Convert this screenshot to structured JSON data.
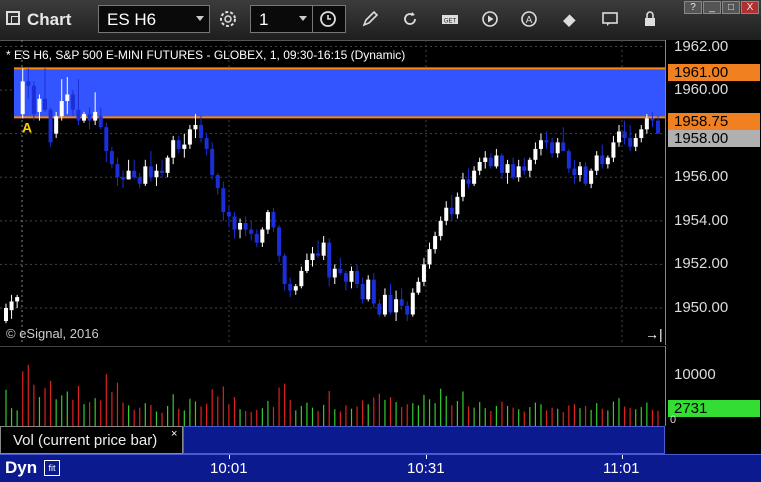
{
  "app": {
    "title": "Chart"
  },
  "toolbar": {
    "symbol": "ES H6",
    "interval": "1",
    "icons": [
      "gear-icon",
      "clock-icon",
      "pencil-icon",
      "refresh-icon",
      "get-icon",
      "play-icon",
      "alert-icon",
      "eraser-icon",
      "comment-icon",
      "lock-icon"
    ]
  },
  "window": {
    "help": "?",
    "minimize": "_",
    "maximize": "□",
    "close": "X"
  },
  "chart_data": {
    "type": "candlestick",
    "title": "* ES H6, S&P 500 E-MINI FUTURES - GLOBEX, 1, 09:30-16:15 (Dynamic)",
    "copyright": "© eSignal, 2016",
    "price_ticks": [
      "1962.00",
      "1960.00",
      "1958.00",
      "1956.00",
      "1954.00",
      "1952.00",
      "1950.00"
    ],
    "ylim": [
      1948.3,
      1962.3
    ],
    "price_tags": [
      {
        "label": "1961.00",
        "color": "#f08020"
      },
      {
        "label": "1958.75",
        "color": "#f08020"
      },
      {
        "label": "1958.00",
        "color": "#b0b0b0"
      }
    ],
    "zone": {
      "top": 1961.0,
      "bottom": 1958.75,
      "color": "#3355ff",
      "marker": "A"
    },
    "candles": [
      [
        1949.4,
        1950.2,
        1949.3,
        1950.0
      ],
      [
        1949.9,
        1950.6,
        1949.5,
        1950.3
      ],
      [
        1950.3,
        1950.6,
        1950.0,
        1950.5
      ],
      [
        1958.9,
        1961.0,
        1958.7,
        1960.4
      ],
      [
        1960.4,
        1961.0,
        1959.6,
        1960.2
      ],
      [
        1960.2,
        1960.4,
        1958.6,
        1958.9
      ],
      [
        1959.0,
        1959.8,
        1958.6,
        1959.6
      ],
      [
        1959.6,
        1961.0,
        1959.0,
        1959.1
      ],
      [
        1959.1,
        1959.2,
        1957.4,
        1957.6
      ],
      [
        1958.0,
        1959.0,
        1957.8,
        1958.8
      ],
      [
        1958.8,
        1960.5,
        1958.6,
        1959.5
      ],
      [
        1959.5,
        1960.6,
        1958.9,
        1959.8
      ],
      [
        1959.8,
        1960.0,
        1958.8,
        1959.1
      ],
      [
        1959.1,
        1960.5,
        1958.4,
        1958.6
      ],
      [
        1958.6,
        1959.0,
        1958.5,
        1958.9
      ],
      [
        1958.9,
        1959.2,
        1958.2,
        1958.6
      ],
      [
        1958.6,
        1959.9,
        1958.4,
        1959.0
      ],
      [
        1958.8,
        1959.2,
        1958.2,
        1958.3
      ],
      [
        1958.3,
        1958.5,
        1956.7,
        1957.2
      ],
      [
        1957.2,
        1957.4,
        1956.4,
        1956.6
      ],
      [
        1956.6,
        1956.9,
        1955.6,
        1956.0
      ],
      [
        1956.0,
        1956.3,
        1955.5,
        1955.9
      ],
      [
        1955.9,
        1956.8,
        1955.9,
        1956.3
      ],
      [
        1956.3,
        1956.8,
        1955.9,
        1956.0
      ],
      [
        1956.0,
        1956.2,
        1955.5,
        1955.7
      ],
      [
        1955.7,
        1956.8,
        1955.6,
        1956.5
      ],
      [
        1956.5,
        1957.2,
        1955.8,
        1956.0
      ],
      [
        1956.0,
        1956.6,
        1955.6,
        1956.3
      ],
      [
        1956.3,
        1956.8,
        1956.0,
        1956.2
      ],
      [
        1956.2,
        1957.0,
        1956.0,
        1956.9
      ],
      [
        1956.9,
        1957.9,
        1956.6,
        1957.7
      ],
      [
        1957.7,
        1957.9,
        1957.1,
        1957.3
      ],
      [
        1957.3,
        1958.0,
        1956.9,
        1957.5
      ],
      [
        1957.5,
        1958.4,
        1957.3,
        1958.2
      ],
      [
        1958.2,
        1958.9,
        1957.8,
        1958.4
      ],
      [
        1958.4,
        1958.8,
        1957.6,
        1957.8
      ],
      [
        1957.8,
        1958.0,
        1957.0,
        1957.3
      ],
      [
        1957.3,
        1957.6,
        1955.9,
        1956.1
      ],
      [
        1956.1,
        1956.2,
        1955.2,
        1955.5
      ],
      [
        1955.5,
        1955.8,
        1954.0,
        1954.4
      ],
      [
        1954.4,
        1954.7,
        1953.7,
        1954.2
      ],
      [
        1954.2,
        1954.4,
        1953.2,
        1953.6
      ],
      [
        1953.6,
        1954.1,
        1953.2,
        1953.9
      ],
      [
        1953.9,
        1954.2,
        1953.3,
        1953.6
      ],
      [
        1953.6,
        1954.0,
        1953.1,
        1953.4
      ],
      [
        1953.4,
        1953.6,
        1952.8,
        1953.0
      ],
      [
        1953.0,
        1953.7,
        1952.8,
        1953.6
      ],
      [
        1953.6,
        1954.5,
        1953.4,
        1954.4
      ],
      [
        1954.4,
        1954.6,
        1953.5,
        1953.7
      ],
      [
        1953.7,
        1953.8,
        1952.1,
        1952.4
      ],
      [
        1952.4,
        1952.5,
        1950.8,
        1951.1
      ],
      [
        1951.1,
        1951.4,
        1950.5,
        1950.8
      ],
      [
        1950.8,
        1951.1,
        1950.6,
        1951.0
      ],
      [
        1951.0,
        1951.9,
        1950.9,
        1951.7
      ],
      [
        1951.7,
        1952.5,
        1951.6,
        1952.2
      ],
      [
        1952.2,
        1952.8,
        1951.9,
        1952.5
      ],
      [
        1952.5,
        1953.1,
        1952.3,
        1952.4
      ],
      [
        1952.4,
        1953.3,
        1952.2,
        1953.0
      ],
      [
        1953.0,
        1953.2,
        1951.0,
        1951.4
      ],
      [
        1951.4,
        1952.0,
        1951.1,
        1951.8
      ],
      [
        1951.8,
        1952.3,
        1951.5,
        1951.6
      ],
      [
        1951.6,
        1951.7,
        1950.8,
        1951.2
      ],
      [
        1951.2,
        1951.9,
        1950.9,
        1951.7
      ],
      [
        1951.7,
        1952.0,
        1950.9,
        1951.1
      ],
      [
        1951.1,
        1951.4,
        1950.2,
        1950.4
      ],
      [
        1950.4,
        1951.5,
        1950.3,
        1951.3
      ],
      [
        1951.3,
        1951.6,
        1950.0,
        1950.2
      ],
      [
        1950.2,
        1950.4,
        1949.6,
        1949.7
      ],
      [
        1949.7,
        1950.9,
        1949.6,
        1950.6
      ],
      [
        1950.6,
        1951.1,
        1949.7,
        1949.8
      ],
      [
        1949.8,
        1950.8,
        1949.4,
        1950.4
      ],
      [
        1950.4,
        1950.9,
        1949.9,
        1950.1
      ],
      [
        1950.1,
        1950.3,
        1949.4,
        1949.7
      ],
      [
        1949.7,
        1950.9,
        1949.6,
        1950.7
      ],
      [
        1950.7,
        1951.4,
        1950.6,
        1951.2
      ],
      [
        1951.2,
        1952.3,
        1951.0,
        1952.0
      ],
      [
        1952.0,
        1953.0,
        1951.8,
        1952.7
      ],
      [
        1952.7,
        1953.5,
        1952.5,
        1953.3
      ],
      [
        1953.3,
        1954.2,
        1953.1,
        1954.0
      ],
      [
        1954.0,
        1954.9,
        1953.8,
        1954.6
      ],
      [
        1954.6,
        1955.2,
        1954.0,
        1954.3
      ],
      [
        1954.3,
        1955.3,
        1954.1,
        1955.1
      ],
      [
        1955.1,
        1956.2,
        1954.9,
        1955.9
      ],
      [
        1955.9,
        1956.4,
        1955.5,
        1955.7
      ],
      [
        1955.7,
        1956.5,
        1955.6,
        1956.3
      ],
      [
        1956.3,
        1956.9,
        1956.1,
        1956.7
      ],
      [
        1956.7,
        1957.2,
        1956.4,
        1956.9
      ],
      [
        1956.9,
        1957.1,
        1956.4,
        1956.5
      ],
      [
        1956.5,
        1957.3,
        1956.4,
        1957.0
      ],
      [
        1957.0,
        1957.1,
        1955.9,
        1956.2
      ],
      [
        1956.2,
        1956.8,
        1955.7,
        1956.6
      ],
      [
        1956.6,
        1956.9,
        1955.9,
        1956.0
      ],
      [
        1956.0,
        1956.8,
        1955.8,
        1956.5
      ],
      [
        1956.5,
        1956.9,
        1956.1,
        1956.3
      ],
      [
        1956.3,
        1956.9,
        1956.0,
        1956.8
      ],
      [
        1956.8,
        1957.6,
        1956.6,
        1957.3
      ],
      [
        1957.3,
        1958.0,
        1957.0,
        1957.7
      ],
      [
        1957.7,
        1958.1,
        1957.3,
        1957.6
      ],
      [
        1957.6,
        1957.8,
        1956.9,
        1957.1
      ],
      [
        1957.1,
        1957.8,
        1956.9,
        1957.6
      ],
      [
        1957.6,
        1958.3,
        1957.2,
        1957.2
      ],
      [
        1957.2,
        1957.3,
        1956.2,
        1956.4
      ],
      [
        1956.4,
        1956.8,
        1955.7,
        1956.1
      ],
      [
        1956.1,
        1956.7,
        1955.8,
        1956.5
      ],
      [
        1956.5,
        1956.7,
        1955.6,
        1955.7
      ],
      [
        1955.7,
        1956.4,
        1955.5,
        1956.3
      ],
      [
        1956.3,
        1957.2,
        1956.1,
        1957.0
      ],
      [
        1957.0,
        1957.5,
        1956.4,
        1956.6
      ],
      [
        1956.6,
        1957.0,
        1956.4,
        1956.9
      ],
      [
        1956.9,
        1957.9,
        1956.7,
        1957.6
      ],
      [
        1957.6,
        1958.4,
        1957.4,
        1958.1
      ],
      [
        1958.1,
        1958.6,
        1957.5,
        1957.8
      ],
      [
        1957.8,
        1958.4,
        1957.2,
        1957.4
      ],
      [
        1957.4,
        1958.0,
        1957.2,
        1957.8
      ],
      [
        1957.8,
        1958.4,
        1957.6,
        1958.2
      ],
      [
        1958.2,
        1958.9,
        1958.0,
        1958.7
      ],
      [
        1958.7,
        1959.0,
        1958.3,
        1958.6
      ],
      [
        1958.6,
        1958.8,
        1958.0,
        1958.0
      ]
    ],
    "volume_ticks": [
      "10000",
      "0"
    ],
    "volume_tag": {
      "label": "2731",
      "color": "#33dd33"
    },
    "volume_label": "Vol (current price bar)",
    "volume_close": "×",
    "volume": [
      [
        6500,
        1
      ],
      [
        3200,
        1
      ],
      [
        2800,
        1
      ],
      [
        9800,
        0
      ],
      [
        11000,
        0
      ],
      [
        7400,
        0
      ],
      [
        5200,
        1
      ],
      [
        6800,
        0
      ],
      [
        8100,
        0
      ],
      [
        4800,
        1
      ],
      [
        5500,
        1
      ],
      [
        6200,
        1
      ],
      [
        4700,
        0
      ],
      [
        7200,
        0
      ],
      [
        3900,
        1
      ],
      [
        4300,
        0
      ],
      [
        5000,
        1
      ],
      [
        4600,
        0
      ],
      [
        9300,
        0
      ],
      [
        6100,
        0
      ],
      [
        7800,
        0
      ],
      [
        4200,
        0
      ],
      [
        3700,
        1
      ],
      [
        2900,
        0
      ],
      [
        3300,
        0
      ],
      [
        4100,
        1
      ],
      [
        3800,
        0
      ],
      [
        2600,
        1
      ],
      [
        2400,
        0
      ],
      [
        3600,
        1
      ],
      [
        5700,
        1
      ],
      [
        3100,
        0
      ],
      [
        2800,
        1
      ],
      [
        4900,
        1
      ],
      [
        4400,
        1
      ],
      [
        3500,
        0
      ],
      [
        4000,
        0
      ],
      [
        6600,
        0
      ],
      [
        5300,
        0
      ],
      [
        7100,
        0
      ],
      [
        3900,
        0
      ],
      [
        5200,
        0
      ],
      [
        3000,
        1
      ],
      [
        2700,
        0
      ],
      [
        2500,
        0
      ],
      [
        2900,
        0
      ],
      [
        3200,
        1
      ],
      [
        4500,
        1
      ],
      [
        3400,
        0
      ],
      [
        6900,
        0
      ],
      [
        7600,
        0
      ],
      [
        4700,
        0
      ],
      [
        2800,
        1
      ],
      [
        3600,
        1
      ],
      [
        4200,
        1
      ],
      [
        3300,
        1
      ],
      [
        2700,
        0
      ],
      [
        3800,
        1
      ],
      [
        6300,
        0
      ],
      [
        3000,
        1
      ],
      [
        2600,
        0
      ],
      [
        3700,
        0
      ],
      [
        3100,
        1
      ],
      [
        3500,
        0
      ],
      [
        4600,
        0
      ],
      [
        3900,
        1
      ],
      [
        5100,
        0
      ],
      [
        5800,
        0
      ],
      [
        4700,
        1
      ],
      [
        5200,
        0
      ],
      [
        4300,
        1
      ],
      [
        3400,
        0
      ],
      [
        3900,
        0
      ],
      [
        4100,
        1
      ],
      [
        3700,
        1
      ],
      [
        5600,
        1
      ],
      [
        4800,
        1
      ],
      [
        4100,
        1
      ],
      [
        6700,
        1
      ],
      [
        5400,
        1
      ],
      [
        3700,
        0
      ],
      [
        4500,
        1
      ],
      [
        6200,
        1
      ],
      [
        3500,
        0
      ],
      [
        3300,
        1
      ],
      [
        4300,
        1
      ],
      [
        3200,
        1
      ],
      [
        2700,
        0
      ],
      [
        3600,
        1
      ],
      [
        4400,
        0
      ],
      [
        3600,
        1
      ],
      [
        3300,
        0
      ],
      [
        3000,
        1
      ],
      [
        2600,
        0
      ],
      [
        3400,
        1
      ],
      [
        4200,
        1
      ],
      [
        3900,
        1
      ],
      [
        2800,
        0
      ],
      [
        3300,
        0
      ],
      [
        3100,
        1
      ],
      [
        2500,
        0
      ],
      [
        3700,
        0
      ],
      [
        3900,
        0
      ],
      [
        3200,
        1
      ],
      [
        3600,
        0
      ],
      [
        2900,
        1
      ],
      [
        4100,
        1
      ],
      [
        3100,
        0
      ],
      [
        2800,
        1
      ],
      [
        4400,
        1
      ],
      [
        5000,
        1
      ],
      [
        3500,
        0
      ],
      [
        3200,
        0
      ],
      [
        3000,
        1
      ],
      [
        3400,
        1
      ],
      [
        4200,
        1
      ],
      [
        2900,
        0
      ],
      [
        2731,
        0
      ]
    ],
    "xlabels": [
      "10:01",
      "10:31",
      "11:01"
    ],
    "colors": {
      "up": "#ffffff",
      "down": "#1a2ed9",
      "vol_up": "#33cc33",
      "vol_down": "#dd2222",
      "zone_line": "#ff8800",
      "grid": "#444444"
    }
  },
  "bottom_bar": {
    "label": "Dyn",
    "icon": "fit-icon"
  },
  "end_icon": "→|"
}
